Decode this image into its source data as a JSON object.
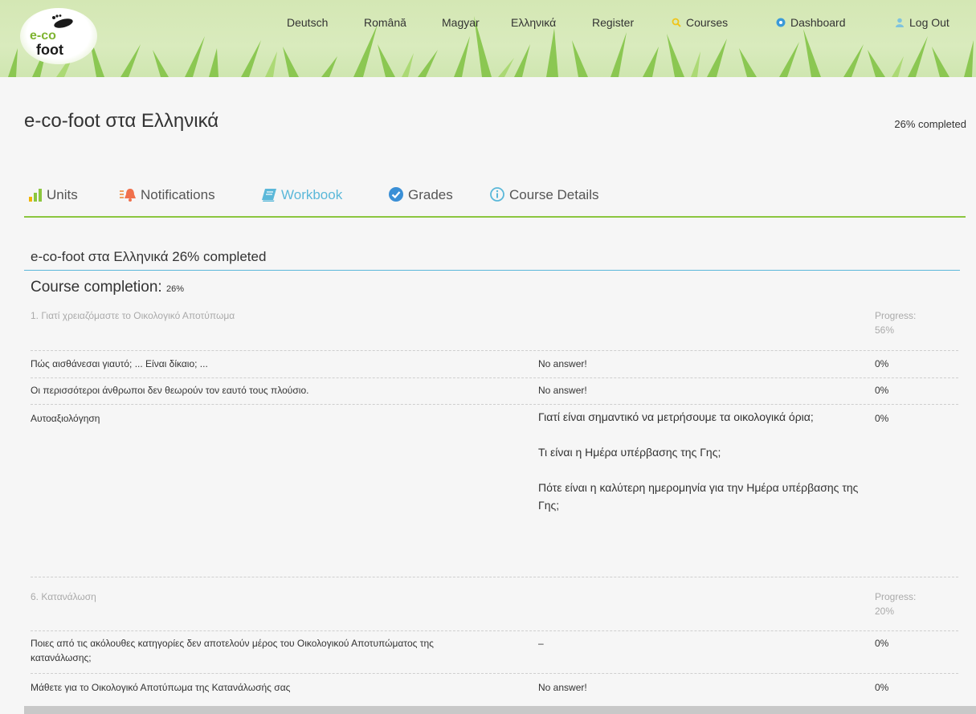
{
  "logo": {
    "line1": "e-co",
    "line2": "foot"
  },
  "nav": {
    "deutsch": "Deutsch",
    "romana": "Română",
    "magyar": "Magyar",
    "ellinika": "Ελληνικά",
    "register": "Register",
    "courses": "Courses",
    "dashboard": "Dashboard",
    "logout": "Log Out"
  },
  "course": {
    "title": "e-co-foot στα Ελληνικά",
    "completed": "26% completed"
  },
  "tabs": {
    "units": "Units",
    "notifications": "Notifications",
    "workbook": "Workbook",
    "grades": "Grades",
    "details": "Course Details"
  },
  "workbook": {
    "heading": "e-co-foot στα Ελληνικά 26% completed",
    "completion_label": "Course completion:",
    "completion_value": "26%",
    "units": [
      {
        "title": "1. Γιατί χρειαζόμαστε το Οικολογικό Αποτύπωμα",
        "progress_label": "Progress:",
        "progress_value": "56%",
        "rows": [
          {
            "question": "Πώς αισθάνεσαι γιαυτό; ... Είναι δίκαιο; ...",
            "answer": "No answer!",
            "score": "0%"
          },
          {
            "question": "Οι περισσότεροι άνθρωποι δεν θεωρούν τον εαυτό τους πλούσιο.",
            "answer": "No answer!",
            "score": "0%"
          },
          {
            "question": "Αυτοαξιολόγηση",
            "answers": [
              "Γιατί είναι σημαντικό να μετρήσουμε τα οικολογικά όρια;",
              "Τι είναι η Ημέρα υπέρβασης της Γης;",
              "Πότε είναι η καλύτερη ημερομηνία για την Ημέρα υπέρβασης της Γης;"
            ],
            "score": "0%"
          }
        ]
      },
      {
        "title": "6. Κατανάλωση",
        "progress_label": "Progress:",
        "progress_value": "20%",
        "rows": [
          {
            "question": "Ποιες από τις ακόλουθες κατηγορίες δεν αποτελούν μέρος του Οικολογικού Αποτυπώματος της κατανάλωσης;",
            "answer": "–",
            "score": "0%"
          },
          {
            "question": "Μάθετε για το Οικολογικό Αποτύπωμα της Κατανάλωσής σας",
            "answer": "No answer!",
            "score": "0%"
          }
        ]
      }
    ]
  },
  "colors": {
    "accent_green": "#8cc63f",
    "accent_blue": "#5bb8d9",
    "muted": "#aaaaaa"
  }
}
